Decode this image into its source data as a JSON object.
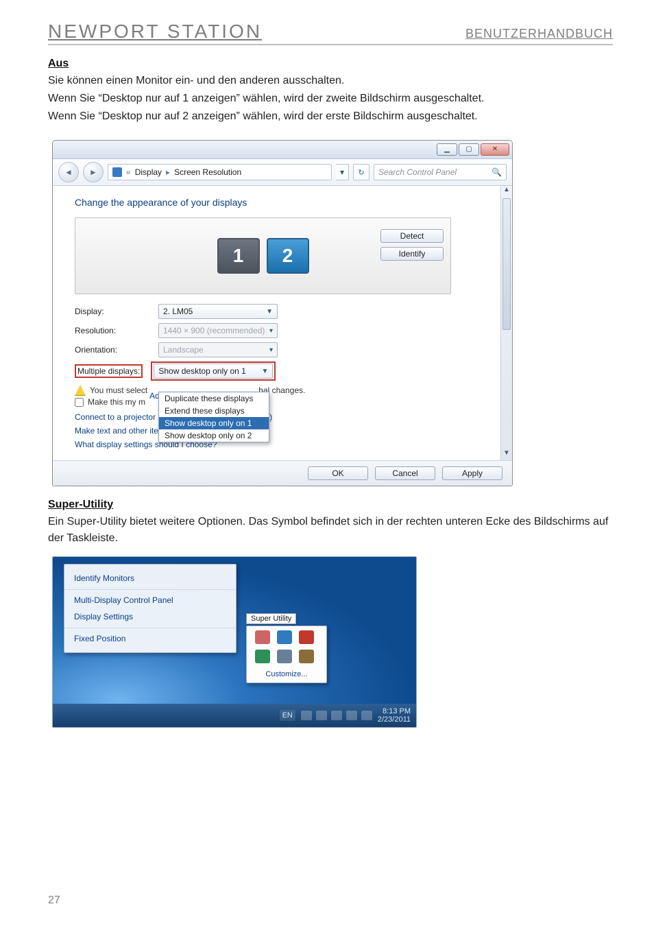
{
  "header": {
    "left": "NEWPORT STATION",
    "right": "BENUTZERHANDBUCH"
  },
  "sec1": {
    "title": "Aus",
    "p1": "Sie können einen Monitor ein- und den anderen ausschalten.",
    "p2": "Wenn Sie “Desktop nur auf 1 anzeigen” wählen, wird der zweite Bildschirm ausgeschaltet.",
    "p3": "Wenn Sie “Desktop nur auf 2 anzeigen” wählen, wird der erste Bildschirm ausgeschaltet."
  },
  "dlg": {
    "breadcrumb": {
      "level1": "Display",
      "level2": "Screen Resolution"
    },
    "search_placeholder": "Search Control Panel",
    "heading": "Change the appearance of your displays",
    "btn_detect": "Detect",
    "btn_identify": "Identify",
    "monitor1": "1",
    "monitor2": "2",
    "labels": {
      "display": "Display:",
      "resolution": "Resolution:",
      "orientation": "Orientation:",
      "multi": "Multiple displays:"
    },
    "values": {
      "display": "2. LM05",
      "resolution": "1440 × 900 (recommended)",
      "orientation": "Landscape",
      "multi": "Show desktop only on 1"
    },
    "popup": {
      "opt1": "Duplicate these displays",
      "opt2": "Extend these displays",
      "opt3": "Show desktop only on 1",
      "opt4": "Show desktop only on 2"
    },
    "warn_a": "You must select",
    "warn_b": "hal changes.",
    "chk": "Make this my m",
    "adv": "Advanced settings",
    "link1a": "Connect to a projector (or press the ",
    "link1b": " key and tap P)",
    "link2": "Make text and other items larger or smaller",
    "link3": "What display settings should I choose?",
    "ok": "OK",
    "cancel": "Cancel",
    "apply": "Apply"
  },
  "sec2": {
    "title": "Super-Utility",
    "p1": "Ein Super-Utility bietet weitere Optionen. Das Symbol befindet sich in der rechten unteren Ecke des Bildschirms auf der Taskleiste."
  },
  "su": {
    "menu": {
      "m1": "Identify Monitors",
      "m2": "Multi-Display Control Panel",
      "m3": "Display Settings",
      "m4": "Fixed Position"
    },
    "tooltip": "Super Utility",
    "customize": "Customize...",
    "lang": "EN",
    "time": "8:13 PM",
    "date": "2/23/2011"
  },
  "page_number": "27"
}
